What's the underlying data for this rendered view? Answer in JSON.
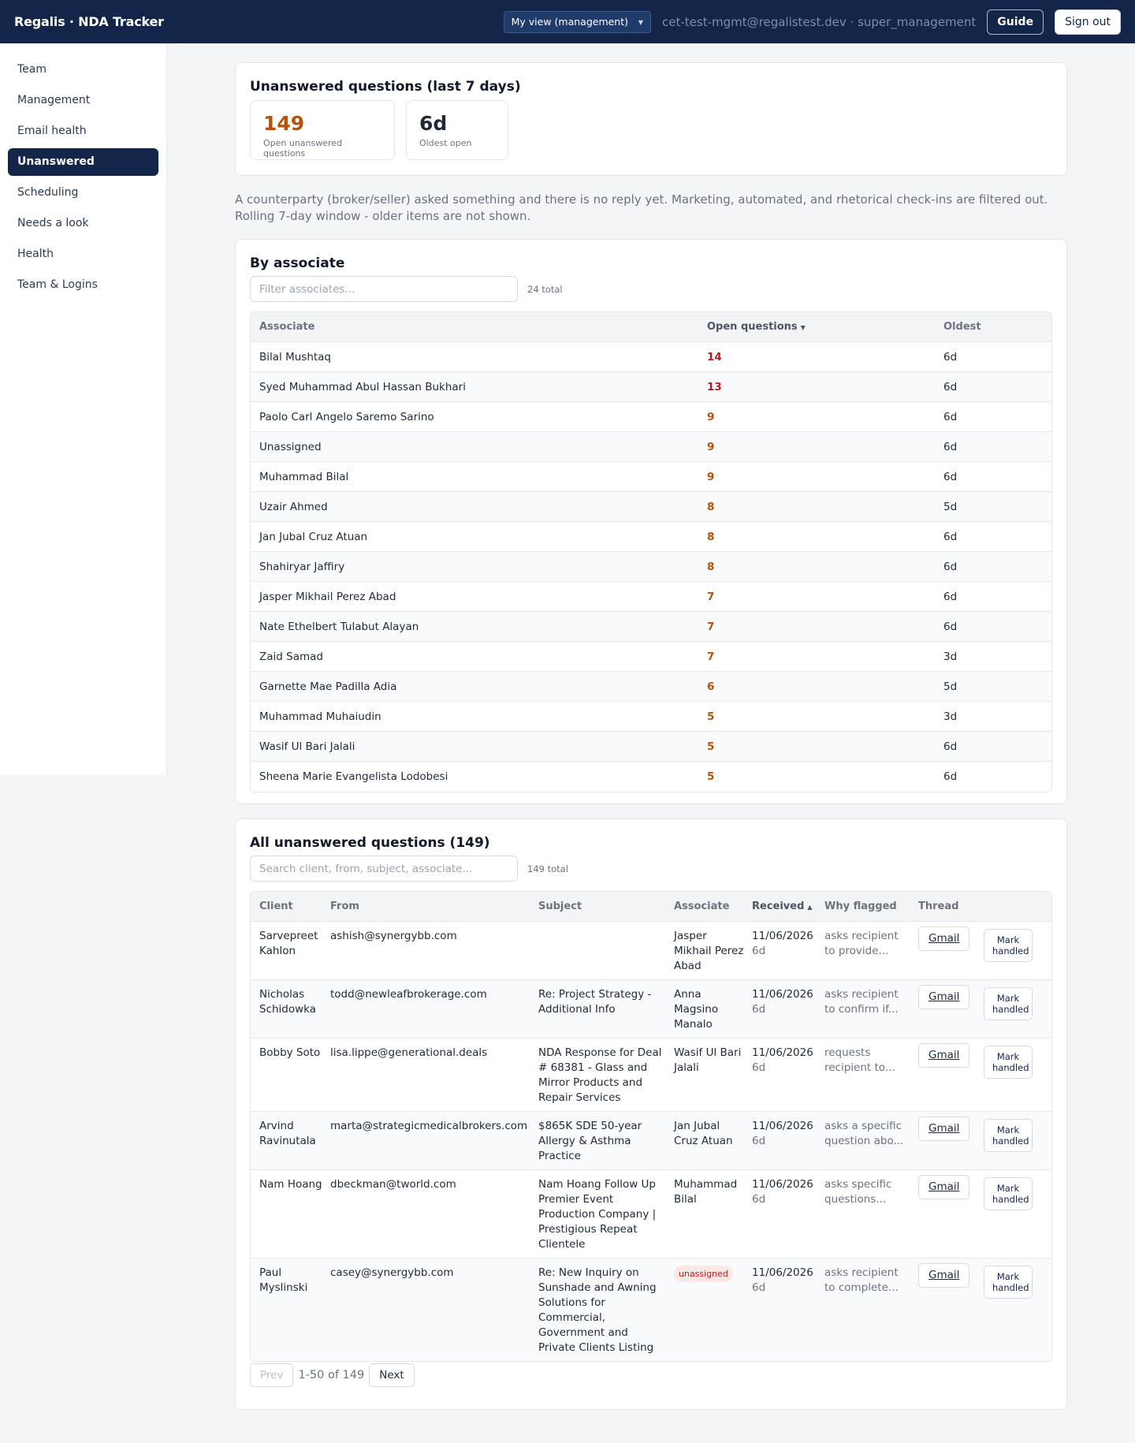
{
  "app": {
    "title": "Regalis · NDA Tracker",
    "view_select": "My view (management)",
    "user_info": "cet-test-mgmt@regalistest.dev · super_management",
    "guide_label": "Guide",
    "signout_label": "Sign out"
  },
  "sidebar": {
    "items": [
      {
        "label": "Team"
      },
      {
        "label": "Management"
      },
      {
        "label": "Email health"
      },
      {
        "label": "Unanswered",
        "active": true
      },
      {
        "label": "Scheduling"
      },
      {
        "label": "Needs a look"
      },
      {
        "label": "Health"
      },
      {
        "label": "Team & Logins"
      }
    ]
  },
  "summary": {
    "title": "Unanswered questions (last 7 days)",
    "open_value": "149",
    "open_label": "Open unanswered questions",
    "oldest_value": "6d",
    "oldest_label": "Oldest open",
    "open_color": "#b45309"
  },
  "description": "A counterparty (broker/seller) asked something and there is no reply yet. Marketing, automated, and rhetorical check-ins are filtered out. Rolling 7-day window - older items are not shown.",
  "by_associate": {
    "title": "By associate",
    "filter_placeholder": "Filter associates...",
    "count": "24 total",
    "headers": {
      "associate": "Associate",
      "open": "Open questions",
      "oldest": "Oldest"
    },
    "rows": [
      {
        "name": "Bilal Mushtaq",
        "open": "14",
        "oldest": "6d",
        "level": "high"
      },
      {
        "name": "Syed Muhammad Abul Hassan Bukhari",
        "open": "13",
        "oldest": "6d",
        "level": "high"
      },
      {
        "name": "Paolo Carl Angelo Saremo Sarino",
        "open": "9",
        "oldest": "6d",
        "level": "mid"
      },
      {
        "name": "Unassigned",
        "open": "9",
        "oldest": "6d",
        "level": "mid"
      },
      {
        "name": "Muhammad Bilal",
        "open": "9",
        "oldest": "6d",
        "level": "mid"
      },
      {
        "name": "Uzair Ahmed",
        "open": "8",
        "oldest": "5d",
        "level": "mid"
      },
      {
        "name": "Jan Jubal Cruz Atuan",
        "open": "8",
        "oldest": "6d",
        "level": "mid"
      },
      {
        "name": "Shahiryar Jaffiry",
        "open": "8",
        "oldest": "6d",
        "level": "mid"
      },
      {
        "name": "Jasper Mikhail Perez Abad",
        "open": "7",
        "oldest": "6d",
        "level": "mid"
      },
      {
        "name": "Nate Ethelbert Tulabut Alayan",
        "open": "7",
        "oldest": "6d",
        "level": "mid"
      },
      {
        "name": "Zaid Samad",
        "open": "7",
        "oldest": "3d",
        "level": "mid"
      },
      {
        "name": "Garnette Mae Padilla Adia",
        "open": "6",
        "oldest": "5d",
        "level": "mid"
      },
      {
        "name": "Muhammad Muhaiudin",
        "open": "5",
        "oldest": "3d",
        "level": "mid"
      },
      {
        "name": "Wasif Ul Bari Jalali",
        "open": "5",
        "oldest": "6d",
        "level": "mid"
      },
      {
        "name": "Sheena Marie Evangelista Lodobesi",
        "open": "5",
        "oldest": "6d",
        "level": "mid"
      }
    ],
    "colors": {
      "high": "#b91c1c",
      "mid": "#b45309"
    }
  },
  "all_questions": {
    "title": "All unanswered questions (149)",
    "search_placeholder": "Search client, from, subject, associate...",
    "count": "149 total",
    "headers": {
      "client": "Client",
      "from": "From",
      "subject": "Subject",
      "associate": "Associate",
      "received": "Received",
      "why": "Why flagged",
      "thread": "Thread"
    },
    "gmail_label": "Gmail",
    "mark_label": "Mark handled",
    "rows": [
      {
        "client": "Sarvepreet Kahlon",
        "from": "ashish@synergybb.com",
        "subject": "",
        "associate": "Jasper Mikhail Perez Abad",
        "date": "11/06/2026",
        "age": "6d",
        "why": "asks recipient to provide..."
      },
      {
        "client": "Nicholas Schidowka",
        "from": "todd@newleafbrokerage.com",
        "subject": "Re: Project Strategy - Additional Info",
        "associate": "Anna Magsino Manalo",
        "date": "11/06/2026",
        "age": "6d",
        "why": "asks recipient to confirm if..."
      },
      {
        "client": "Bobby Soto",
        "from": "lisa.lippe@generational.deals",
        "subject": "NDA Response for Deal # 68381 - Glass and Mirror Products and Repair Services",
        "associate": "Wasif Ul Bari Jalali",
        "date": "11/06/2026",
        "age": "6d",
        "why": "requests recipient to..."
      },
      {
        "client": "Arvind Ravinutala",
        "from": "marta@strategicmedicalbrokers.com",
        "subject": "$865K SDE 50-year Allergy & Asthma Practice",
        "associate": "Jan Jubal Cruz Atuan",
        "date": "11/06/2026",
        "age": "6d",
        "why": "asks a specific question abo..."
      },
      {
        "client": "Nam Hoang",
        "from": "dbeckman@tworld.com",
        "subject": "Nam Hoang Follow Up Premier Event Production Company | Prestigious Repeat Clientele",
        "associate": "Muhammad Bilal",
        "date": "11/06/2026",
        "age": "6d",
        "why": "asks specific questions..."
      },
      {
        "client": "Paul Myslinski",
        "from": "casey@synergybb.com",
        "subject": "Re: New Inquiry on Sunshade and Awning Solutions for Commercial, Government and Private Clients Listing",
        "associate": "unassigned",
        "unassigned": true,
        "date": "11/06/2026",
        "age": "6d",
        "why": "asks recipient to complete..."
      }
    ]
  },
  "pagination": {
    "prev": "Prev",
    "info": "1-50 of 149",
    "next": "Next"
  }
}
